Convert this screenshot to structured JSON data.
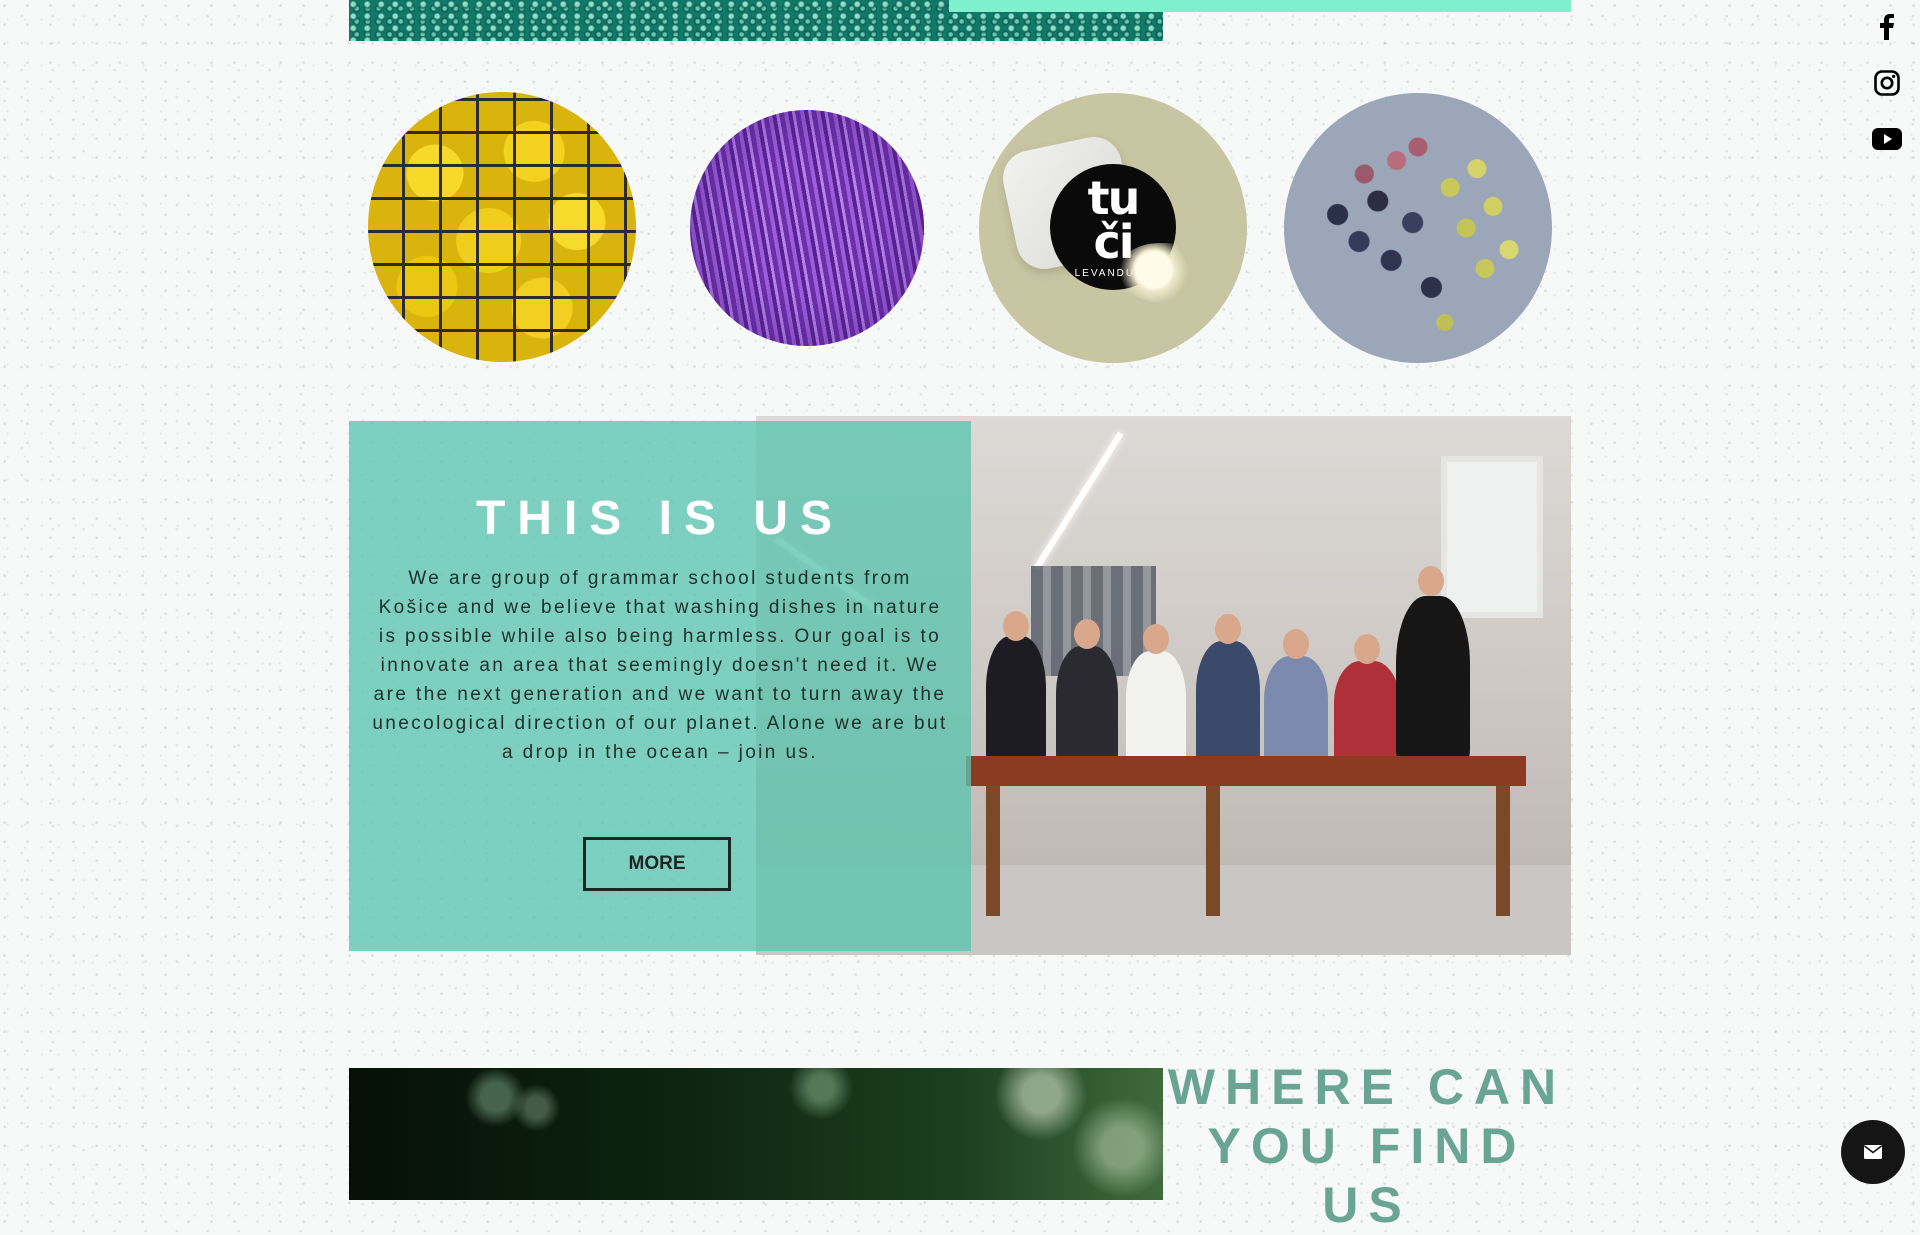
{
  "social": {
    "facebook": "facebook-icon",
    "instagram": "instagram-icon",
    "youtube": "youtube-icon"
  },
  "circles": [
    {
      "name": "lemons",
      "alt": "basket of lemons"
    },
    {
      "name": "lavender",
      "alt": "lavender field"
    },
    {
      "name": "tuci-logo",
      "alt": "tu či levanduľa soap logo"
    },
    {
      "name": "grapes",
      "alt": "black and white grapes"
    }
  ],
  "logo": {
    "main_top": "tu",
    "main_bottom": "či",
    "sub": "LEVANDUĽA"
  },
  "about": {
    "title": "THIS IS US",
    "text": "We are group of grammar school students from Košice and we believe that washing dishes in nature is possible while also being harmless. Our goal is to innovate an area that seemingly doesn't need it. We are the next generation and we want to turn away the unecological direction of our planet. Alone we are but a drop in the ocean – join us.",
    "button": "MORE"
  },
  "find": {
    "title": "WHERE CAN YOU FIND US"
  },
  "colors": {
    "accent": "#5bc4ae",
    "heading_green": "#6aa593",
    "top_accent": "#7ff0cc"
  },
  "chat": {
    "icon": "mail-icon"
  }
}
